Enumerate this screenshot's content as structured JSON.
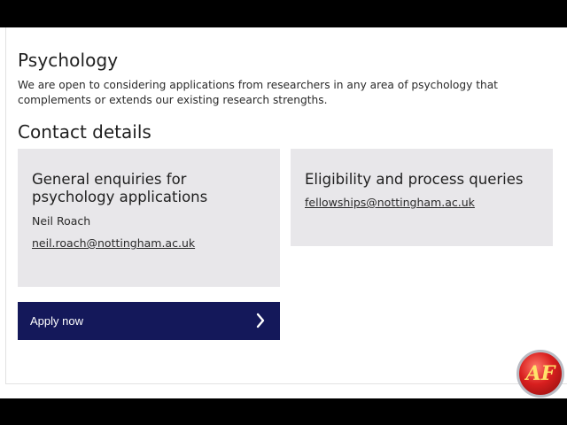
{
  "section": {
    "title": "Psychology",
    "intro_line1": "We are open to considering applications from researchers in any area of psychology that",
    "intro_line2": "complements or extends our existing research strengths."
  },
  "contact": {
    "title": "Contact details",
    "cards": [
      {
        "heading_line1": "General enquiries for",
        "heading_line2": "psychology applications",
        "person": "Neil Roach",
        "email": "neil.roach@nottingham.ac.uk"
      },
      {
        "heading_line1": "Eligibility and process queries",
        "email": "fellowships@nottingham.ac.uk"
      }
    ]
  },
  "apply_button": {
    "label": "Apply now",
    "icon": "chevron-right-icon"
  },
  "watermark": {
    "text": "AF"
  },
  "colors": {
    "card_background": "#e8e7ea",
    "button_background": "#14185a",
    "page_background": "#ffffff"
  }
}
